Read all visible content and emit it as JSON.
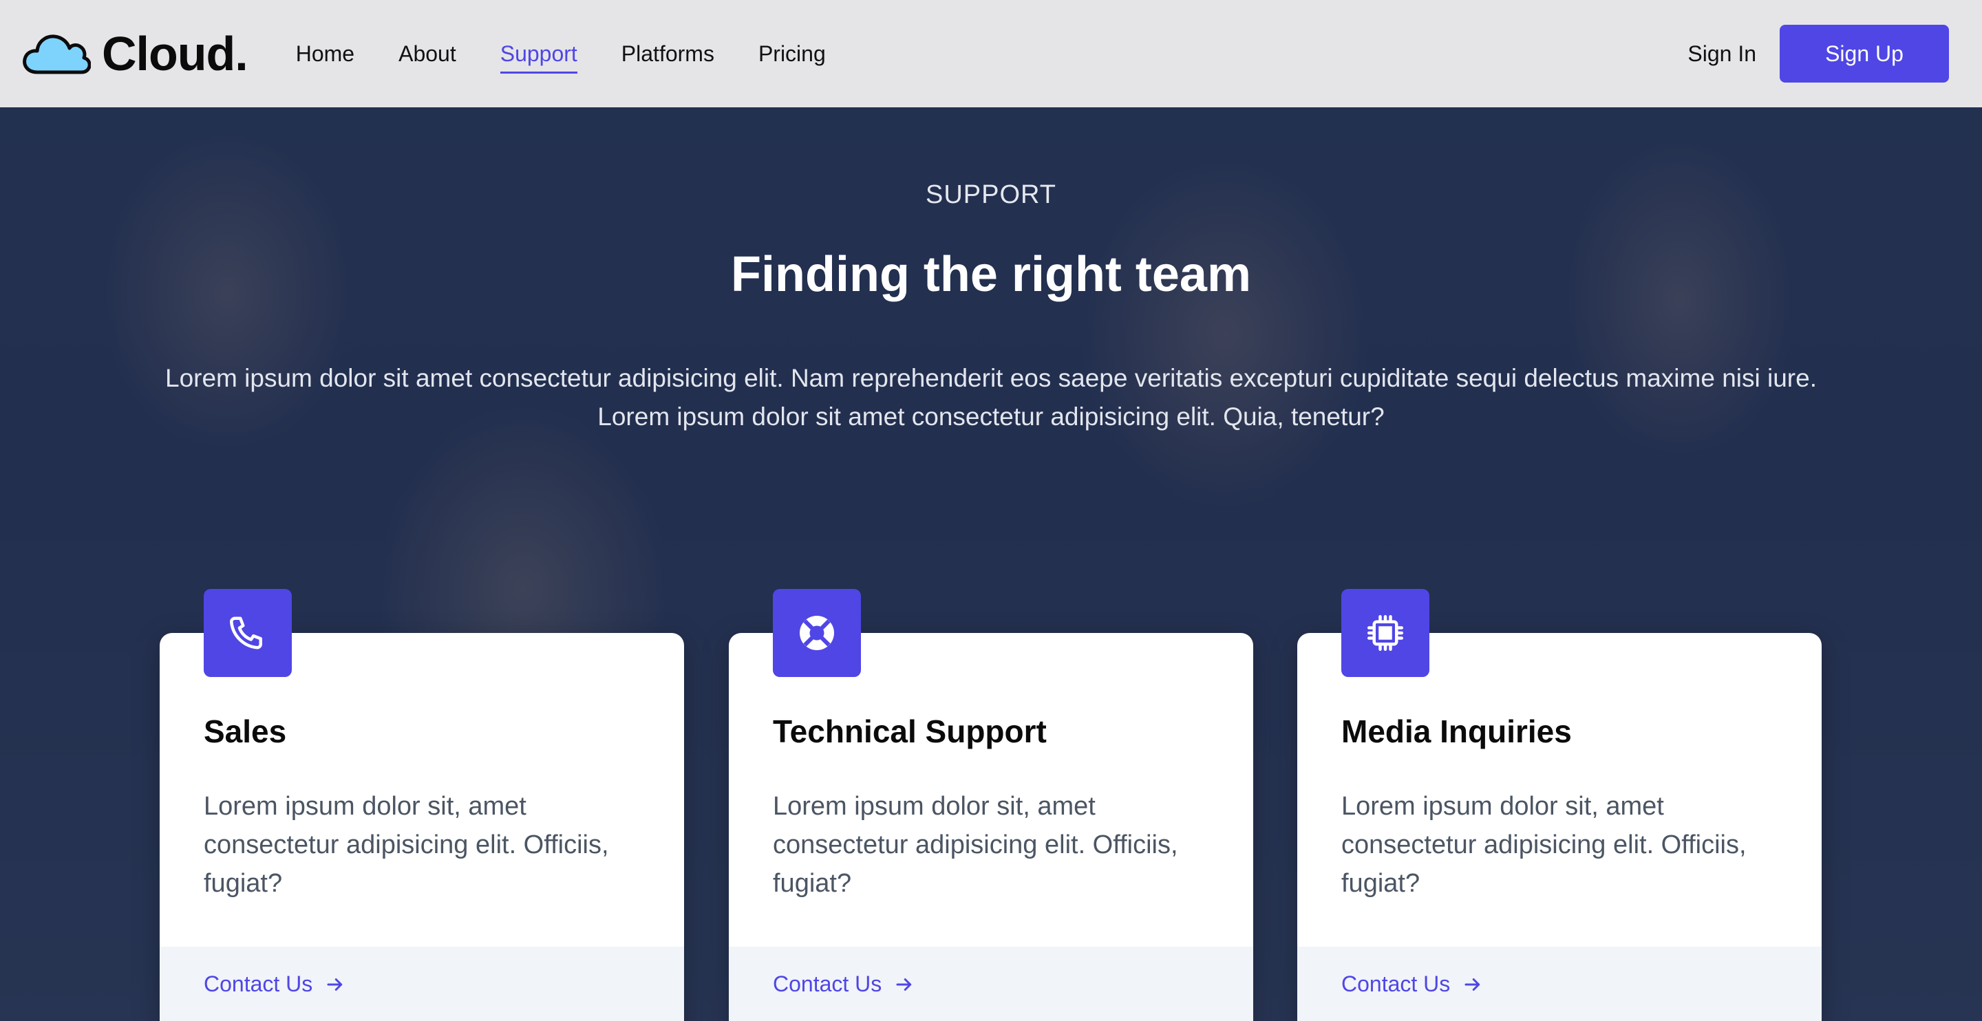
{
  "brand": {
    "name": "Cloud.",
    "icon": "cloud-icon"
  },
  "nav": {
    "items": [
      {
        "label": "Home"
      },
      {
        "label": "About"
      },
      {
        "label": "Support",
        "active": true
      },
      {
        "label": "Platforms"
      },
      {
        "label": "Pricing"
      }
    ],
    "sign_in": "Sign In",
    "sign_up": "Sign Up"
  },
  "hero": {
    "eyebrow": "SUPPORT",
    "title": "Finding the right team",
    "description": "Lorem ipsum dolor sit amet consectetur adipisicing elit. Nam reprehenderit eos saepe veritatis excepturi cupiditate sequi delectus maxime nisi iure. Lorem ipsum dolor sit amet consectetur adipisicing elit. Quia, tenetur?"
  },
  "cards": [
    {
      "icon": "phone-icon",
      "title": "Sales",
      "text": "Lorem ipsum dolor sit, amet consectetur adipisicing elit. Officiis, fugiat?",
      "link": "Contact Us"
    },
    {
      "icon": "lifebuoy-icon",
      "title": "Technical Support",
      "text": "Lorem ipsum dolor sit, amet consectetur adipisicing elit. Officiis, fugiat?",
      "link": "Contact Us"
    },
    {
      "icon": "chip-icon",
      "title": "Media Inquiries",
      "text": "Lorem ipsum dolor sit, amet consectetur adipisicing elit. Officiis, fugiat?",
      "link": "Contact Us"
    }
  ],
  "colors": {
    "accent": "#4f46e5",
    "header_bg": "#e5e5e8",
    "cloud_fill": "#7dd3fc",
    "card_footer_bg": "#f1f4f9"
  }
}
